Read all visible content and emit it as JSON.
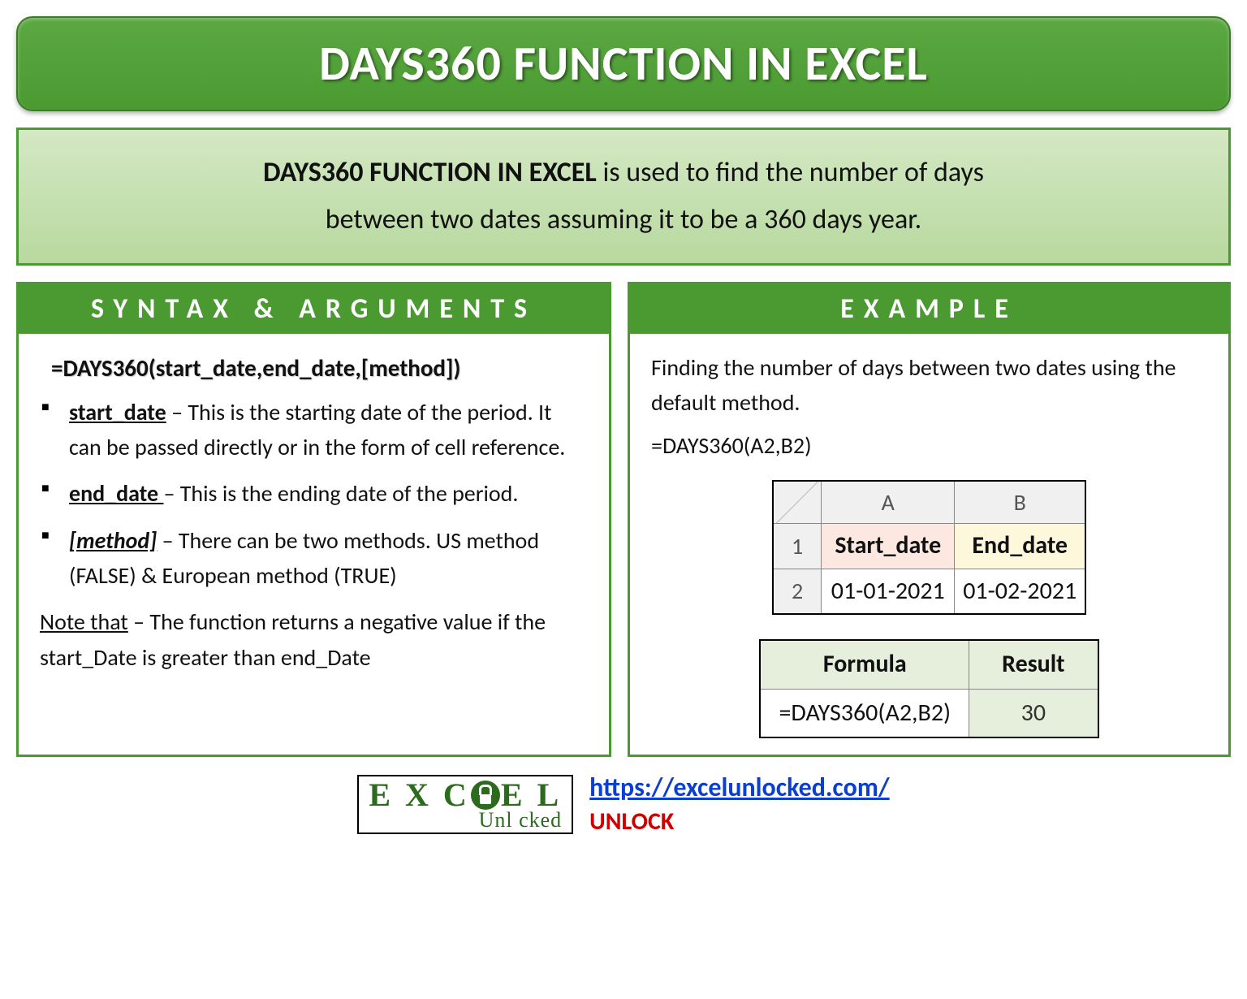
{
  "title": "DAYS360 FUNCTION IN EXCEL",
  "description": {
    "bold": "DAYS360 FUNCTION IN EXCEL",
    "rest1": " is used to find the number of days",
    "rest2": "between two dates assuming it to be a 360 days year."
  },
  "syntax": {
    "heading": "SYNTAX & ARGUMENTS",
    "formula": "=DAYS360(start_date,end_date,[method])",
    "args": [
      {
        "name": "start_date",
        "desc": " – This is the starting date of the period. It can be passed directly or in the form of cell reference.",
        "italic": false
      },
      {
        "name": "end_date ",
        "desc": "– This is the ending date of the period.",
        "italic": false
      },
      {
        "name": "[method]",
        "desc": " – There can be two methods. US method (FALSE) & European method (TRUE)",
        "italic": true
      }
    ],
    "note_label": "Note that",
    "note_text": " – The function returns a negative value if the start_Date is greater than end_Date"
  },
  "example": {
    "heading": "EXAMPLE",
    "intro1": "Finding the number of days between two dates using the default method.",
    "intro2": "=DAYS360(A2,B2)",
    "table1": {
      "col_a": "A",
      "col_b": "B",
      "row1": "1",
      "row2": "2",
      "a1": "Start_date",
      "b1": "End_date",
      "a2": "01-01-2021",
      "b2": "01-02-2021"
    },
    "table2": {
      "h1": "Formula",
      "h2": "Result",
      "formula": "=DAYS360(A2,B2)",
      "result": "30"
    }
  },
  "footer": {
    "logo_top_1": "E X C",
    "logo_top_2": "E L",
    "logo_bottom": "Unl   cked",
    "url": "https://excelunlocked.com/",
    "unlock": "UNLOCK"
  }
}
